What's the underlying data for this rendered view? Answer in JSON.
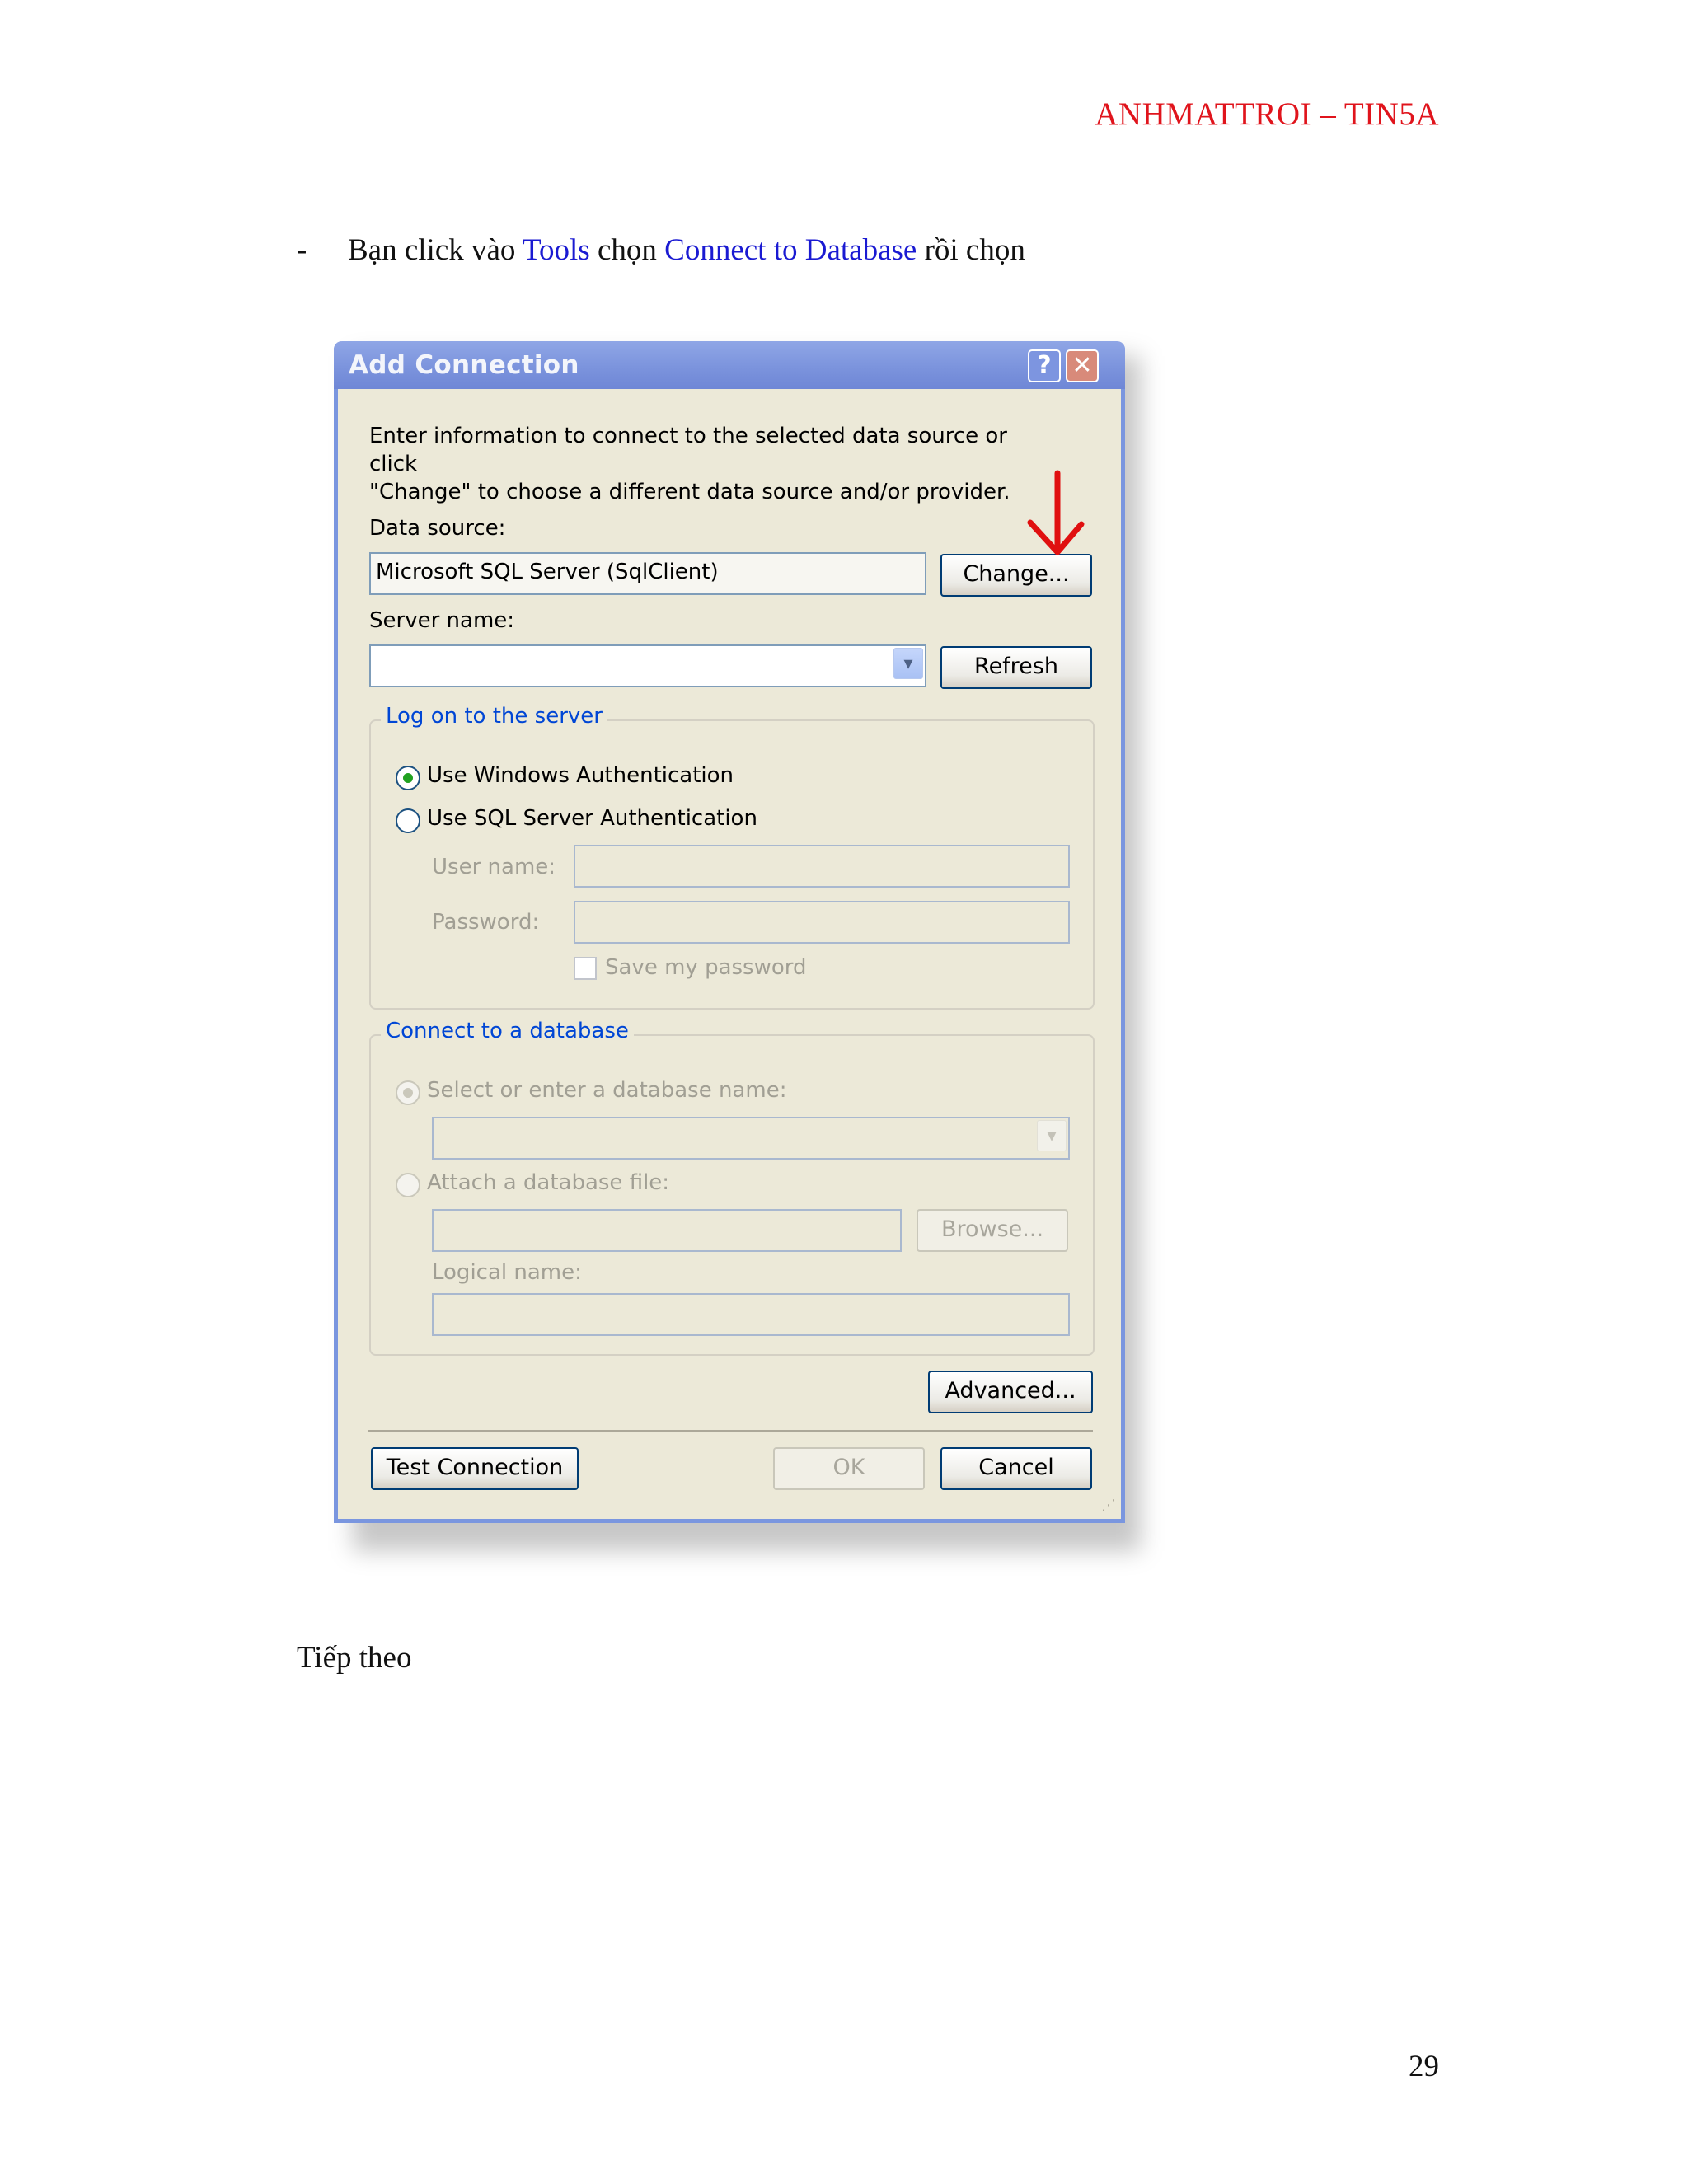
{
  "header": {
    "text": "ANHMATTROI – TIN5A"
  },
  "instruction": {
    "dash": "-",
    "part1": "Bạn click vào ",
    "tools": "Tools",
    "part2": " chọn ",
    "connect": "Connect to Database",
    "part3": " rồi chọn"
  },
  "dialog": {
    "title": "Add Connection",
    "help_label": "?",
    "close_label": "✕",
    "intro_line1": "Enter information to connect to the selected data source or click",
    "intro_line2": "\"Change\" to choose a different data source and/or provider.",
    "data_source_label": "Data source:",
    "data_source_value": "Microsoft SQL Server (SqlClient)",
    "change_button": "Change...",
    "server_name_label": "Server name:",
    "server_name_value": "",
    "refresh_button": "Refresh",
    "logon_group": {
      "legend": "Log on to the server",
      "windows_auth": "Use Windows Authentication",
      "sql_auth": "Use SQL Server Authentication",
      "user_name_label": "User name:",
      "password_label": "Password:",
      "save_password": "Save my password",
      "selected": "windows_auth"
    },
    "database_group": {
      "legend": "Connect to a database",
      "select_db": "Select or enter a database name:",
      "attach_file": "Attach a database file:",
      "browse_button": "Browse...",
      "logical_name_label": "Logical name:"
    },
    "advanced_button": "Advanced...",
    "test_connection_button": "Test Connection",
    "ok_button": "OK",
    "cancel_button": "Cancel",
    "arrow_glyph": "▾",
    "grip_glyph": "⋰"
  },
  "next_text": "Tiếp theo",
  "page_number": "29",
  "colors": {
    "header": "#e0141c",
    "link": "#1a1ad2",
    "annotation_arrow": "#e01010"
  }
}
